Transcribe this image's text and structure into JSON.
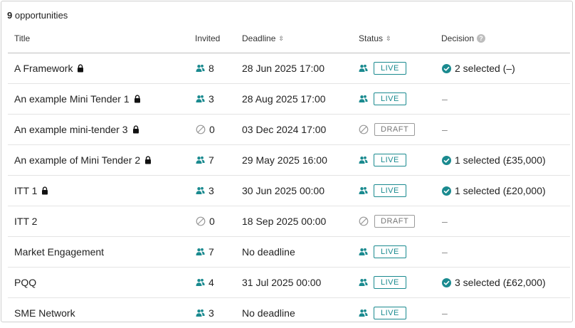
{
  "header": {
    "count": "9",
    "count_label": "opportunities"
  },
  "columns": {
    "title": "Title",
    "invited": "Invited",
    "deadline": "Deadline",
    "status": "Status",
    "decision": "Decision"
  },
  "rows": [
    {
      "title": "A Framework",
      "locked": true,
      "invited": "8",
      "invited_icon": "users-icon",
      "deadline": "28 Jun 2025 17:00",
      "status": "LIVE",
      "decision": "2 selected (–)"
    },
    {
      "title": "An example Mini Tender 1",
      "locked": true,
      "invited": "3",
      "invited_icon": "users-icon",
      "deadline": "28 Aug 2025 17:00",
      "status": "LIVE",
      "decision": "–"
    },
    {
      "title": "An example mini-tender 3",
      "locked": true,
      "invited": "0",
      "invited_icon": "none-icon",
      "deadline": "03 Dec 2024 17:00",
      "status": "DRAFT",
      "decision": "–"
    },
    {
      "title": "An example of Mini Tender 2",
      "locked": true,
      "invited": "7",
      "invited_icon": "users-icon",
      "deadline": "29 May 2025 16:00",
      "status": "LIVE",
      "decision": "1 selected (£35,000)"
    },
    {
      "title": "ITT 1",
      "locked": true,
      "invited": "3",
      "invited_icon": "users-icon",
      "deadline": "30 Jun 2025 00:00",
      "status": "LIVE",
      "decision": "1 selected (£20,000)"
    },
    {
      "title": "ITT 2",
      "locked": false,
      "invited": "0",
      "invited_icon": "none-icon",
      "deadline": "18 Sep 2025 00:00",
      "status": "DRAFT",
      "decision": "–"
    },
    {
      "title": "Market Engagement",
      "locked": false,
      "invited": "7",
      "invited_icon": "users-icon",
      "deadline": "No deadline",
      "status": "LIVE",
      "decision": "–"
    },
    {
      "title": "PQQ",
      "locked": false,
      "invited": "4",
      "invited_icon": "users-icon",
      "deadline": "31 Jul 2025 00:00",
      "status": "LIVE",
      "decision": "3 selected (£62,000)"
    },
    {
      "title": "SME Network",
      "locked": false,
      "invited": "3",
      "invited_icon": "users-icon",
      "deadline": "No deadline",
      "status": "LIVE",
      "decision": "–"
    }
  ],
  "colors": {
    "accent": "#1a8a8f",
    "draft": "#777777"
  }
}
